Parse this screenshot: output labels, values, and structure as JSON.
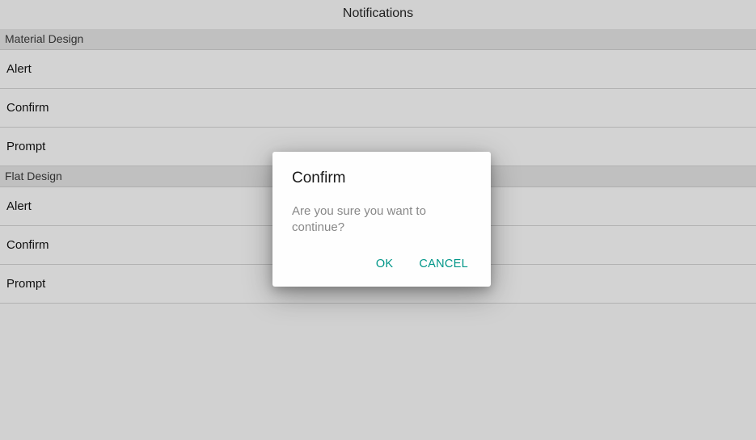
{
  "header": {
    "title": "Notifications"
  },
  "sections": [
    {
      "header": "Material Design",
      "items": [
        "Alert",
        "Confirm",
        "Prompt"
      ]
    },
    {
      "header": "Flat Design",
      "items": [
        "Alert",
        "Confirm",
        "Prompt"
      ]
    }
  ],
  "dialog": {
    "title": "Confirm",
    "message": "Are you sure you want to continue?",
    "ok_label": "OK",
    "cancel_label": "CANCEL"
  }
}
